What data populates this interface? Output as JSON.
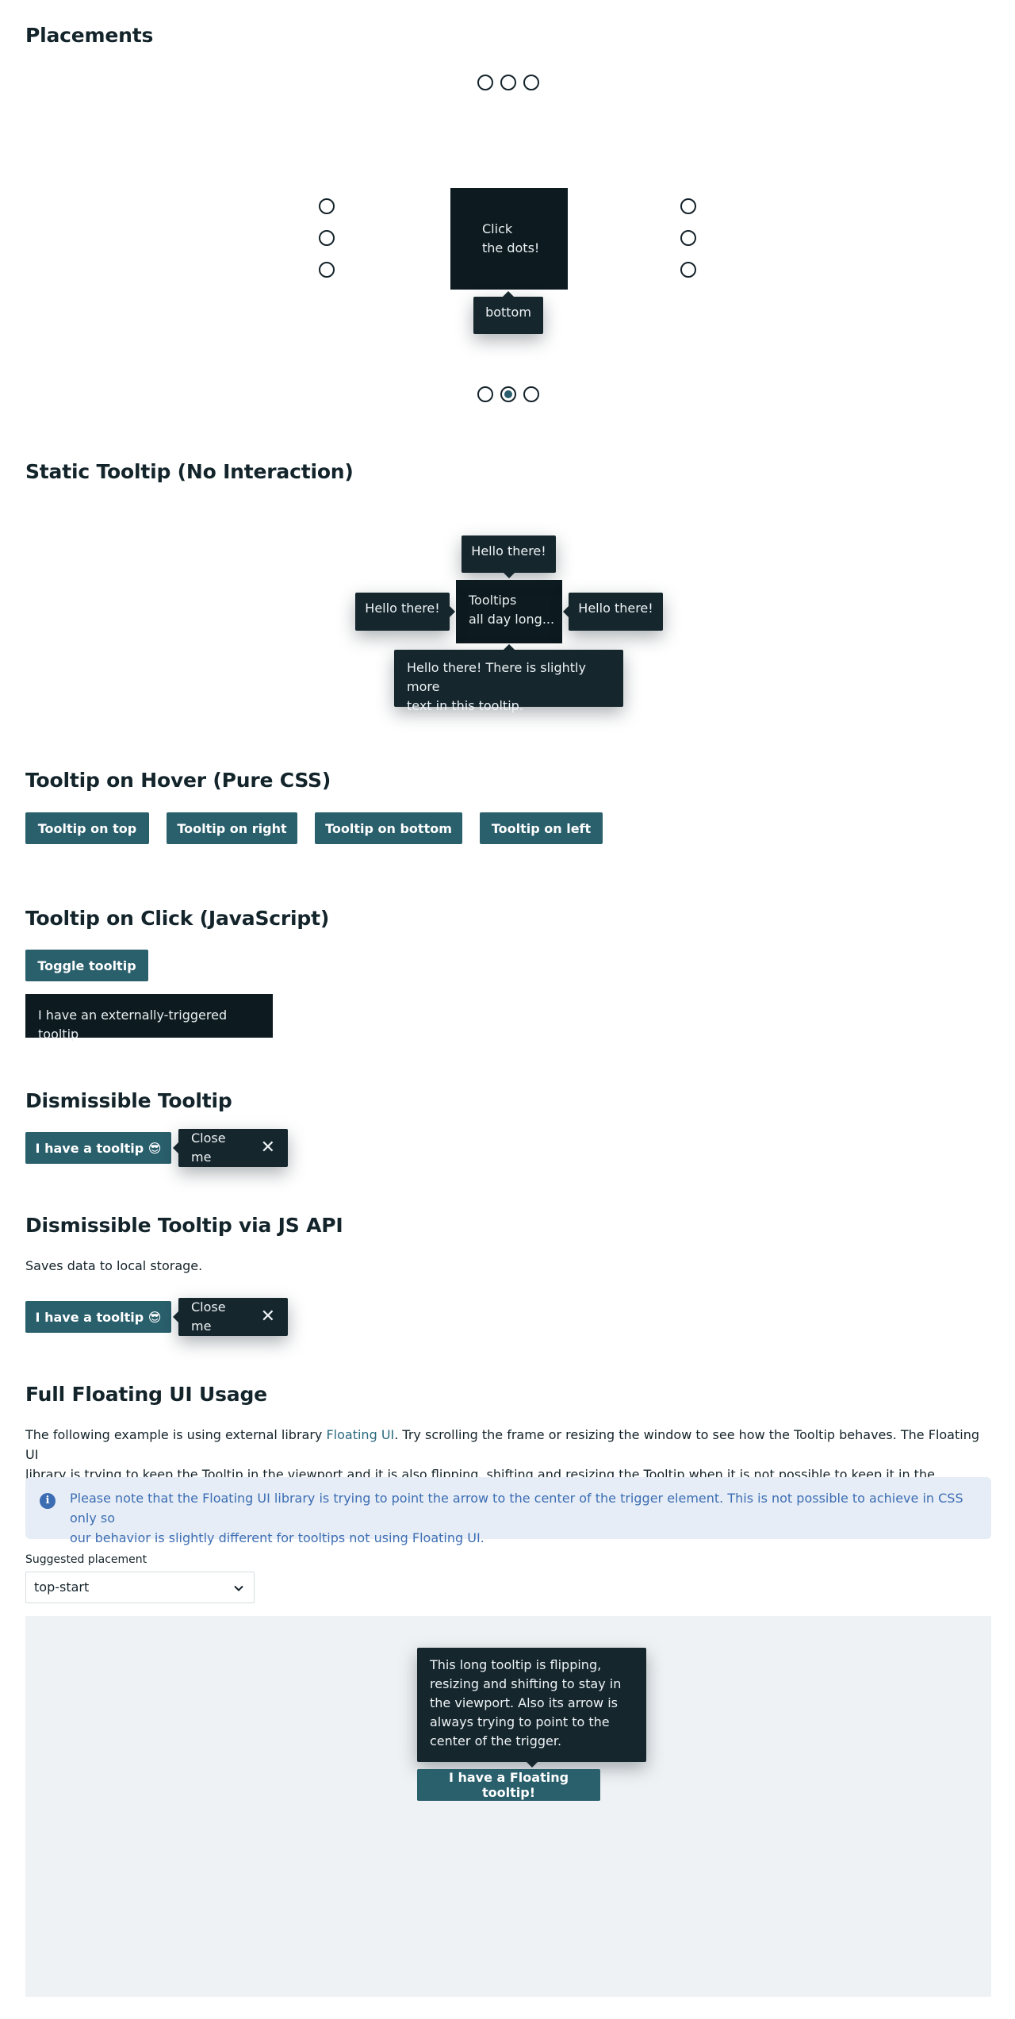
{
  "sections": {
    "placements": "Placements",
    "static": "Static Tooltip (No Interaction)",
    "hover": "Tooltip on Hover (Pure CSS)",
    "click": "Tooltip on Click (JavaScript)",
    "dismissible": "Dismissible Tooltip",
    "dismissible_js": "Dismissible Tooltip via JS API",
    "floating": "Full Floating UI Usage"
  },
  "placements": {
    "center_line1": "Click",
    "center_line2": "the dots!",
    "tooltip": "bottom"
  },
  "static": {
    "center_line1": "Tooltips",
    "center_line2": "all day long...",
    "top": "Hello there!",
    "left": "Hello there!",
    "right": "Hello there!",
    "bottom_line1": "Hello there! There is slightly more",
    "bottom_line2": "text in this tooltip."
  },
  "hover": {
    "top": "Tooltip on top",
    "right": "Tooltip on right",
    "bottom": "Tooltip on bottom",
    "left": "Tooltip on left"
  },
  "click": {
    "button": "Toggle tooltip",
    "tooltip": "I have an externally-triggered tooltip"
  },
  "dismissible": {
    "button": "I have a tooltip 😎",
    "tooltip": "Close me"
  },
  "dismissible_js": {
    "description": "Saves data to local storage.",
    "button": "I have a tooltip 😎",
    "tooltip": "Close me"
  },
  "floating": {
    "p_before": "The following example is using external library ",
    "p_link": "Floating UI",
    "p_after_line1": ". Try scrolling the frame or resizing the window to see how the Tooltip behaves. The Floating UI",
    "p_line2": "library is trying to keep the Tooltip in the viewport and it is also flipping, shifting and resizing the Tooltip when it is not possible to keep it in the viewport.",
    "note_line1": "Please note that the Floating UI library is trying to point the arrow to the center of the trigger element. This is not possible to achieve in CSS only so",
    "note_line2": "our behavior is slightly different for tooltips not using Floating UI.",
    "select_label": "Suggested placement",
    "select_value": "top-start",
    "tooltip_lines": [
      "This long tooltip is flipping,",
      "resizing and shifting to stay in",
      "the viewport. Also its arrow is",
      "always trying to point to the",
      "center of the trigger."
    ],
    "button": "I have a Floating tooltip!"
  },
  "colors": {
    "primary": "#2a5f6c",
    "tooltip_bg": "#15262d",
    "note_bg": "#e6edf6",
    "note_text": "#3c6db3",
    "frame_bg": "#eff2f4"
  },
  "icons": [
    "radio-dot",
    "close-icon",
    "info-icon",
    "chevron-down-icon"
  ]
}
